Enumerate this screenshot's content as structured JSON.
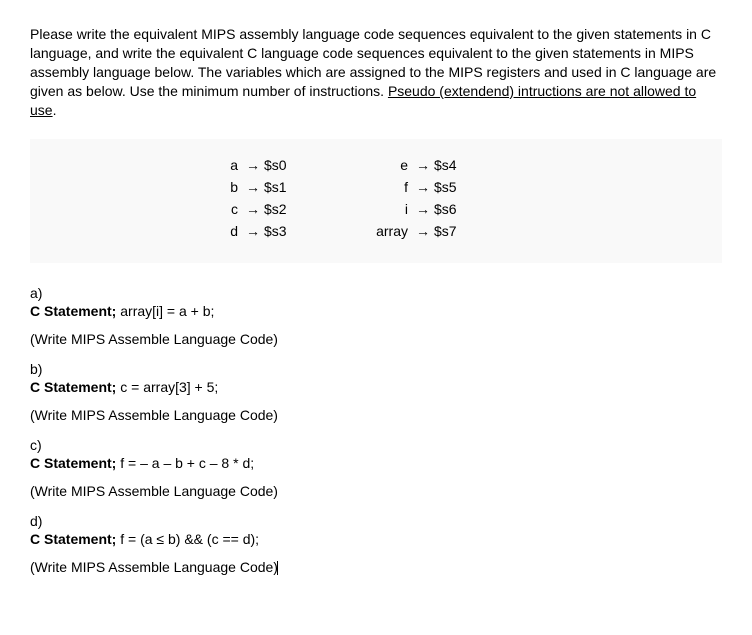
{
  "intro": {
    "text1": "Please write the equivalent MIPS assembly language code sequences equivalent to the given statements in C language, and write the equivalent C language code sequences equivalent to the given statements in MIPS assembly language below. The variables which are assigned to the MIPS registers and used in C language are given as below. Use the minimum number of instructions. ",
    "underlined": "Pseudo (extendend) intructions are not allowed to use",
    "period": "."
  },
  "mappings": [
    {
      "left_var": "a",
      "left_reg": "$s0",
      "right_var": "e",
      "right_reg": "$s4"
    },
    {
      "left_var": "b",
      "left_reg": "$s1",
      "right_var": "f",
      "right_reg": "$s5"
    },
    {
      "left_var": "c",
      "left_reg": "$s2",
      "right_var": "i",
      "right_reg": "$s6"
    },
    {
      "left_var": "d",
      "left_reg": "$s3",
      "right_var": "array",
      "right_reg": "$s7"
    }
  ],
  "arrow": "→",
  "problems": {
    "a": {
      "label": "a)",
      "stmt_prefix": "C Statement;",
      "stmt": " array[i] = a + b;",
      "write": "(Write MIPS Assemble Language Code)"
    },
    "b": {
      "label": "b)",
      "stmt_prefix": "C Statement;",
      "stmt": " c = array[3] + 5;",
      "write": "(Write MIPS Assemble Language Code)"
    },
    "c": {
      "label": "c)",
      "stmt_prefix": "C Statement;",
      "stmt": " f = – a – b + c – 8 * d;",
      "write": "(Write MIPS Assemble Language Code)"
    },
    "d": {
      "label": "d)",
      "stmt_prefix": "C Statement;",
      "stmt": " f = (a ≤ b) && (c == d);",
      "write": "(Write MIPS Assemble Language Code)"
    }
  }
}
